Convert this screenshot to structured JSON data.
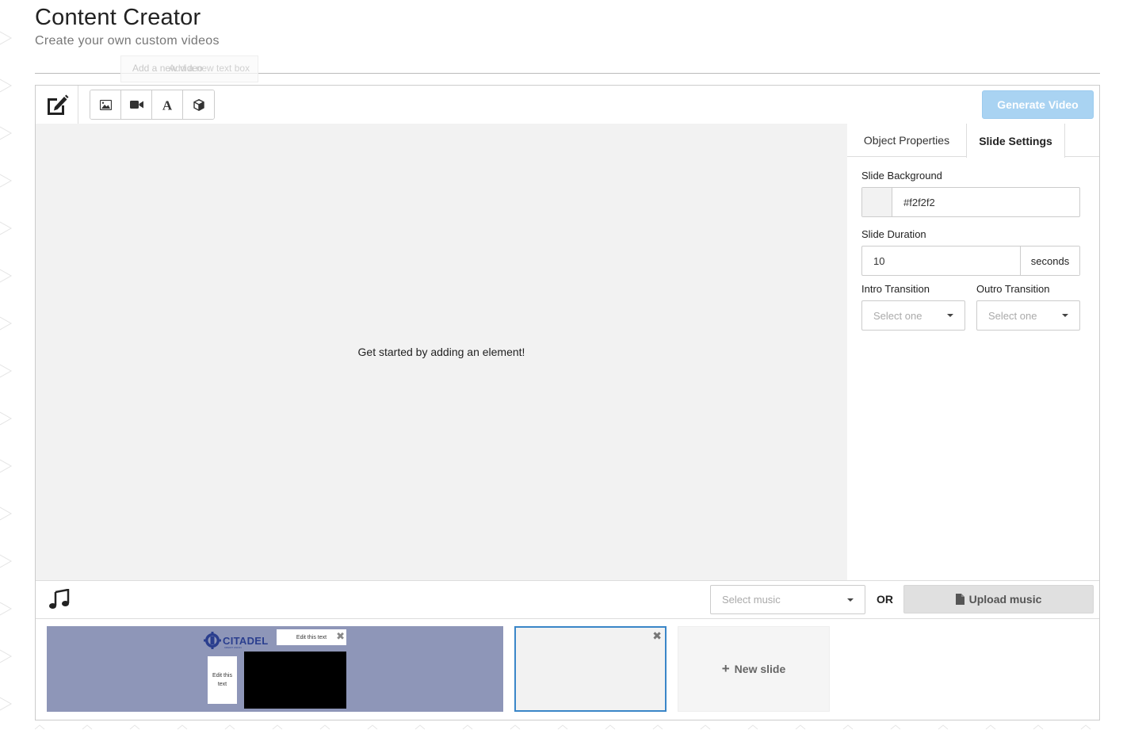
{
  "header": {
    "title": "Content Creator",
    "subtitle": "Create your own custom videos"
  },
  "tooltip": {
    "text_back": "Add a new text box",
    "text_front": "Add a new video"
  },
  "toolbar": {
    "tools": [
      "image-icon",
      "video-camera-icon",
      "text-icon",
      "cube-icon"
    ],
    "generate_label": "Generate Video",
    "generate_color": "#a9d3f2"
  },
  "canvas": {
    "hint": "Get started by adding an element!",
    "background": "#f2f2f2"
  },
  "panel": {
    "tabs": {
      "object": "Object Properties",
      "slide": "Slide Settings"
    },
    "active_tab": "Slide Settings",
    "slide_background_label": "Slide Background",
    "slide_background_value": "#f2f2f2",
    "slide_duration_label": "Slide Duration",
    "slide_duration_value": "10",
    "slide_duration_unit": "seconds",
    "intro_label": "Intro Transition",
    "intro_placeholder": "Select one",
    "outro_label": "Outro Transition",
    "outro_placeholder": "Select one"
  },
  "music": {
    "select_placeholder": "Select music",
    "or_label": "OR",
    "upload_label": "Upload music"
  },
  "slides": {
    "slide1": {
      "logo_text": "CITADEL",
      "logo_sub": "CREDIT UNION",
      "top_text": "Edit this text",
      "left_text": "Edit this text",
      "background": "#8e96b8"
    },
    "slide2": {
      "background": "#f2f2f2",
      "selected": true
    },
    "new_slide_label": "New slide"
  }
}
